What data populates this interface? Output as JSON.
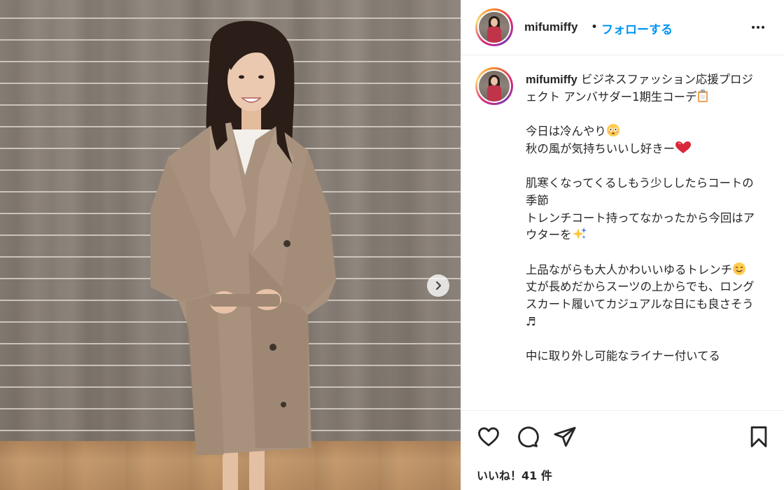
{
  "post": {
    "username": "mifumiffy",
    "separator": "•",
    "follow_label": "フォローする",
    "more_icon": "more-horizontal-icon",
    "next_icon": "chevron-right-icon"
  },
  "caption": {
    "username": "mifumiffy",
    "line1": "ビジネスファッション応援プロジェクト アンバサダー1期生コーデ",
    "line2": "今日は冷んやり",
    "line3": "秋の風が気持ちいいし好きー",
    "line4": "肌寒くなってくるしもう少ししたらコートの季節",
    "line5": "トレンチコート持ってなかったから今回はアウターを",
    "line6": "上品ながらも大人かわいいゆるトレンチ",
    "line7": "丈が長めだからスーツの上からでも、ロングスカート履いてカジュアルな日にも良さそう♬",
    "line8": "中に取り外し可能なライナー付いてる"
  },
  "actions": {
    "like_icon": "heart-icon",
    "comment_icon": "comment-icon",
    "share_icon": "paper-plane-icon",
    "save_icon": "bookmark-icon"
  },
  "likes": {
    "text": "いいね！41 件"
  },
  "colors": {
    "follow": "#0095f6",
    "text": "#262626",
    "border": "#efefef"
  }
}
